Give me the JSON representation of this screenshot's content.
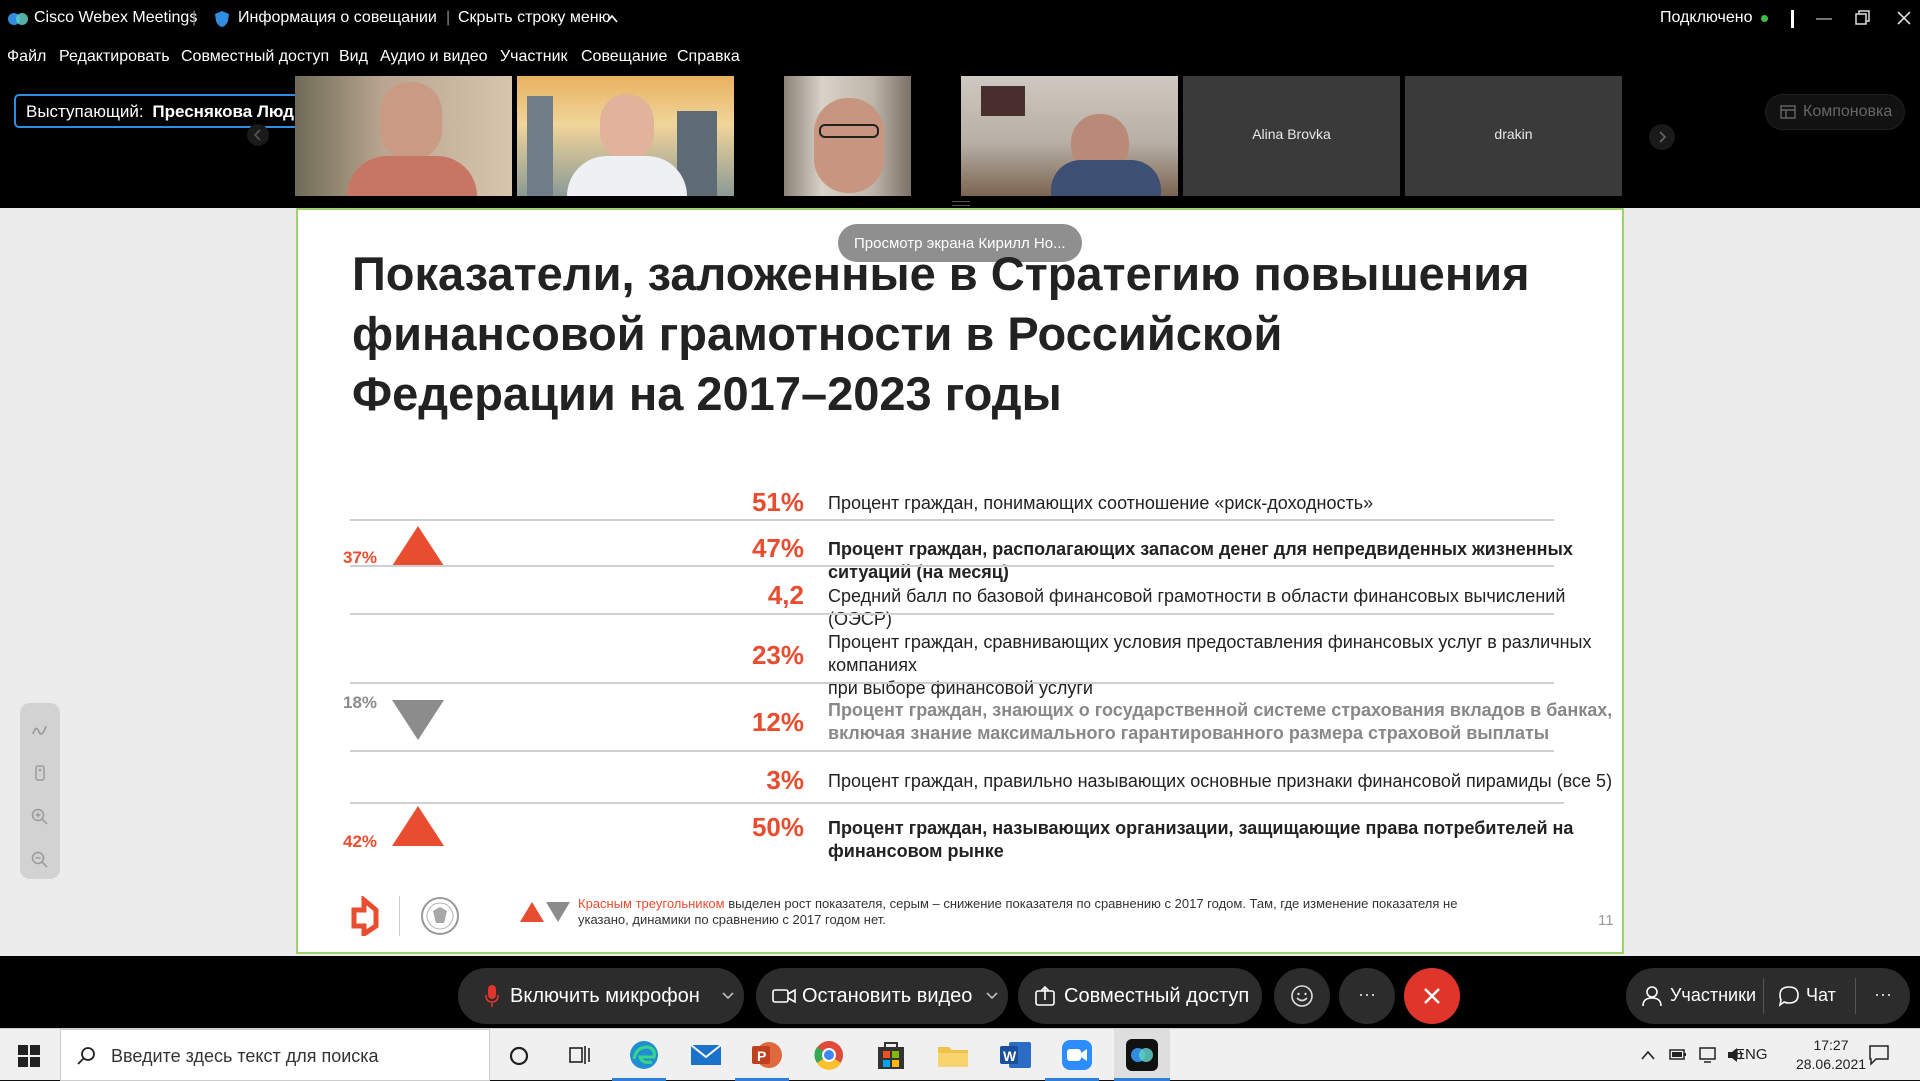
{
  "window": {
    "app_name": "Cisco Webex Meetings",
    "meeting_info": "Информация о совещании",
    "hide_menu": "Скрыть строку меню",
    "status": "Подключено",
    "status_color": "#3fbf3f"
  },
  "menu": [
    "Файл",
    "Редактировать",
    "Совместный доступ",
    "Вид",
    "Аудио и видео",
    "Участник",
    "Совещание",
    "Справка"
  ],
  "speaker": {
    "prefix": "Выступающий:",
    "name": "Преснякова Людмила ФОМ"
  },
  "participants": [
    {
      "name": "",
      "has_video": true
    },
    {
      "name": "",
      "has_video": true
    },
    {
      "name": "",
      "has_video": true
    },
    {
      "name": "",
      "has_video": true
    },
    {
      "name": "Alina Brovka",
      "has_video": false
    },
    {
      "name": "drakin",
      "has_video": false
    }
  ],
  "layout_button": "Компоновка",
  "screen_share_tag": "Просмотр экрана Кирилл Но...",
  "slide": {
    "title_lines": [
      "Показатели, заложенные в Стратегию повышения",
      "финансовой грамотности в Российской",
      "Федерации на 2017–2023 годы"
    ],
    "rows": [
      {
        "value": "51%",
        "text": [
          "Процент граждан, понимающих соотношение «риск-доходность»"
        ],
        "style": "normal",
        "trend": "",
        "prev": ""
      },
      {
        "value": "47%",
        "text": [
          "Процент граждан, располагающих запасом денег для непредвиденных жизненных ситуаций (на месяц)"
        ],
        "style": "bold",
        "trend": "up",
        "prev": "37%"
      },
      {
        "value": "4,2",
        "text": [
          "Средний балл по базовой финансовой грамотности в области финансовых вычислений (ОЭСР)"
        ],
        "style": "normal",
        "trend": "",
        "prev": ""
      },
      {
        "value": "23%",
        "text": [
          "Процент граждан, сравнивающих условия предоставления финансовых услуг в различных компаниях",
          "при выборе финансовой услуги"
        ],
        "style": "normal",
        "trend": "",
        "prev": ""
      },
      {
        "value": "12%",
        "text": [
          "Процент граждан, знающих о государственной системе страхования вкладов в банках,",
          "включая знание максимального гарантированного размера страховой выплаты"
        ],
        "style": "grey",
        "trend": "down",
        "prev": "18%"
      },
      {
        "value": "3%",
        "text": [
          "Процент граждан, правильно называющих основные признаки финансовой пирамиды (все 5)"
        ],
        "style": "normal",
        "trend": "",
        "prev": ""
      },
      {
        "value": "50%",
        "text": [
          "Процент граждан, называющих организации, защищающие права потребителей на финансовом рынке"
        ],
        "style": "bold",
        "trend": "up",
        "prev": "42%"
      }
    ],
    "footnote_red": "Красным треугольником",
    "footnote_line1": " выделен рост показателя, серым – снижение показателя по сравнению с 2017 годом. Там, где изменение показателя не",
    "footnote_line2": "указано, динамики по сравнению с 2017 годом нет.",
    "page_number": "11",
    "accent_color": "#e84d2f",
    "grey_color": "#8c8c8c"
  },
  "controls": {
    "mic": "Включить микрофон",
    "video": "Остановить видео",
    "share": "Совместный доступ",
    "participants": "Участники",
    "chat": "Чат",
    "more": "···",
    "end_color": "#e0352b"
  },
  "taskbar": {
    "search_placeholder": "Введите здесь текст для поиска",
    "lang": "ENG",
    "time": "17:27",
    "date": "28.06.2021"
  }
}
